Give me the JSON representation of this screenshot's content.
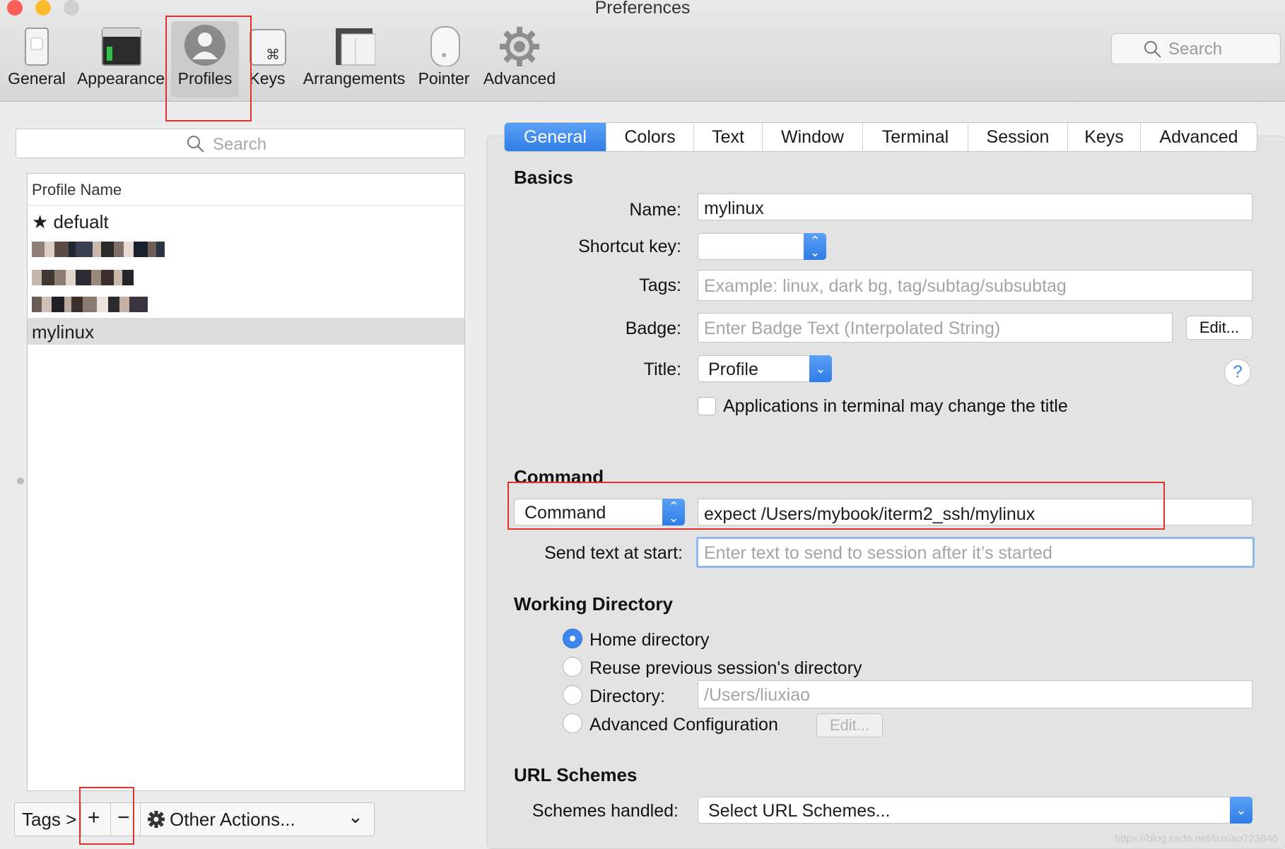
{
  "window": {
    "title": "Preferences"
  },
  "toolbar": {
    "items": [
      {
        "label": "General",
        "icon": "general-switch-icon"
      },
      {
        "label": "Appearance",
        "icon": "appearance-window-icon"
      },
      {
        "label": "Profiles",
        "icon": "profiles-person-icon",
        "selected": true
      },
      {
        "label": "Keys",
        "icon": "keys-command-icon"
      },
      {
        "label": "Arrangements",
        "icon": "arrangements-windows-icon"
      },
      {
        "label": "Pointer",
        "icon": "pointer-mouse-icon"
      },
      {
        "label": "Advanced",
        "icon": "advanced-gear-icon"
      }
    ],
    "search_placeholder": "Search"
  },
  "profiles": {
    "search_placeholder": "Search",
    "column_header": "Profile Name",
    "items": [
      {
        "name": "★ defualt",
        "selected": false,
        "redacted": false
      },
      {
        "name": "",
        "selected": false,
        "redacted": true
      },
      {
        "name": "",
        "selected": false,
        "redacted": true
      },
      {
        "name": "",
        "selected": false,
        "redacted": true
      },
      {
        "name": "mylinux",
        "selected": true,
        "redacted": false
      }
    ],
    "bottom_bar": {
      "tags_label": "Tags >",
      "add_label": "+",
      "remove_label": "−",
      "other_actions_label": "Other Actions...",
      "other_actions_chevron": "⌄"
    }
  },
  "tabs": [
    {
      "label": "General",
      "active": true
    },
    {
      "label": "Colors",
      "active": false
    },
    {
      "label": "Text",
      "active": false
    },
    {
      "label": "Window",
      "active": false
    },
    {
      "label": "Terminal",
      "active": false
    },
    {
      "label": "Session",
      "active": false
    },
    {
      "label": "Keys",
      "active": false
    },
    {
      "label": "Advanced",
      "active": false
    }
  ],
  "basics": {
    "heading": "Basics",
    "name_label": "Name:",
    "name_value": "mylinux",
    "shortcut_label": "Shortcut key:",
    "shortcut_value": "",
    "tags_label": "Tags:",
    "tags_placeholder": "Example: linux, dark bg, tag/subtag/subsubtag",
    "badge_label": "Badge:",
    "badge_placeholder": "Enter Badge Text (Interpolated String)",
    "badge_edit": "Edit...",
    "title_label": "Title:",
    "title_value": "Profile",
    "help": "?",
    "apps_change_title": "Applications in terminal may change the title",
    "apps_change_title_checked": false
  },
  "command": {
    "heading": "Command",
    "type_value": "Command",
    "command_value": "expect /Users/mybook/iterm2_ssh/mylinux",
    "send_text_label": "Send text at start:",
    "send_text_placeholder": "Enter text to send to session after it’s started"
  },
  "working_directory": {
    "heading": "Working Directory",
    "options": [
      {
        "label": "Home directory",
        "selected": true
      },
      {
        "label": "Reuse previous session's directory",
        "selected": false
      },
      {
        "label": "Directory:",
        "selected": false
      },
      {
        "label": "Advanced Configuration",
        "selected": false
      }
    ],
    "directory_placeholder": "/Users/liuxiao",
    "advanced_edit": "Edit..."
  },
  "url_schemes": {
    "heading": "URL Schemes",
    "label": "Schemes handled:",
    "value": "Select URL Schemes..."
  },
  "watermark": "https://blog.csdn.net/liuxiao723846",
  "colors": {
    "accent": "#3d86ee",
    "annotation_red": "#e0312f",
    "close": "#fc5f57",
    "minimize": "#fdbc2e",
    "zoom": "#cfcfcf"
  }
}
